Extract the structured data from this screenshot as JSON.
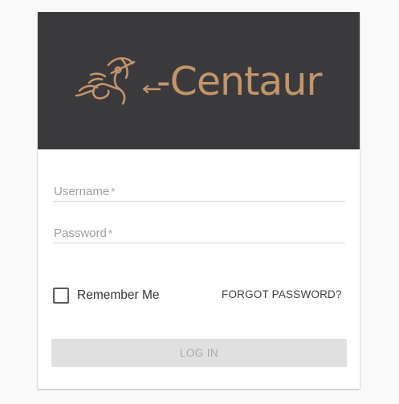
{
  "brand": {
    "name": "-Centaur",
    "color": "#c2956a",
    "banner_color": "#3a393b",
    "logo_icon": "centaur-archer-icon"
  },
  "form": {
    "username": {
      "label": "Username",
      "required_mark": "*",
      "value": ""
    },
    "password": {
      "label": "Password",
      "required_mark": "*",
      "value": ""
    },
    "remember_me": {
      "label": "Remember Me",
      "checked": false
    },
    "forgot_password_label": "FORGOT PASSWORD?",
    "login_label": "LOG IN",
    "login_disabled": true
  }
}
